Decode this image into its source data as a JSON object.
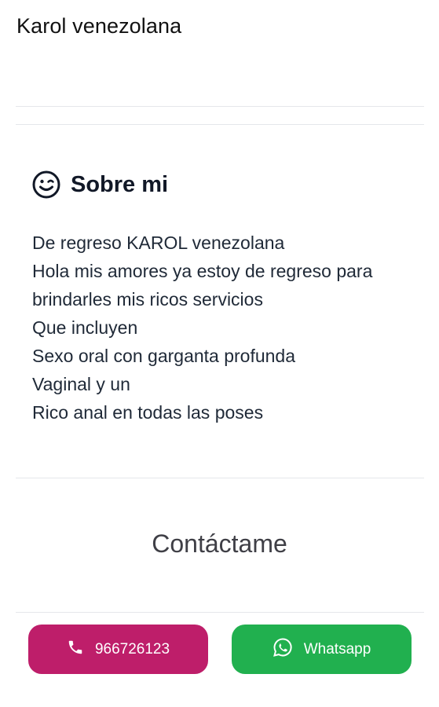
{
  "profile": {
    "name": "Karol venezolana"
  },
  "about": {
    "icon": "smile-wink-icon",
    "title": "Sobre mi",
    "lines": [
      "De regreso KAROL venezolana",
      "Hola mis amores ya estoy de regreso para",
      "brindarles mis ricos servicios",
      "Que incluyen",
      "Sexo oral con garganta profunda",
      "Vaginal y un",
      "Rico anal en todas las poses"
    ]
  },
  "contact": {
    "title": "Contáctame",
    "call_button": {
      "icon": "phone-icon",
      "label": "966726123",
      "color": "#be1e6a"
    },
    "whatsapp_button": {
      "icon": "whatsapp-icon",
      "label": "Whatsapp",
      "color": "#21b04f"
    }
  }
}
